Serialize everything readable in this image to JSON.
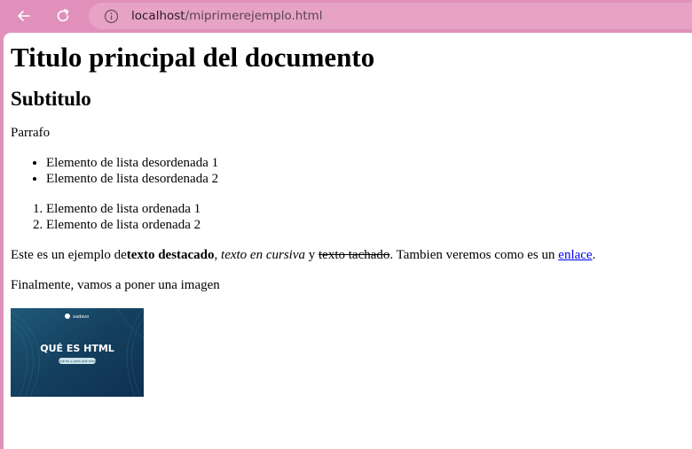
{
  "browser": {
    "url_host": "localhost",
    "url_path": "/miprimerejemplo.html"
  },
  "page": {
    "title": "Titulo principal del documento",
    "subtitle": "Subtitulo",
    "paragraph": "Parrafo",
    "unordered_list": [
      "Elemento de lista desordenada 1",
      "Elemento de lista desordenada 2"
    ],
    "ordered_list": [
      "Elemento de lista ordenada 1",
      "Elemento de lista ordenada 2"
    ],
    "example": {
      "before": "Este es un ejemplo de",
      "bold": "texto destacado",
      "sep1": ", ",
      "italic": "texto en cursiva",
      "sep2": " y ",
      "strike": "texto tachado",
      "after": ". Tambien veremos como es un ",
      "link": "enlace",
      "end": "."
    },
    "final_paragraph": "Finalmente, vamos a poner una imagen",
    "image": {
      "brand": "xadavo",
      "heading": "QUÉ ES HTML",
      "pill": "¿Qué es y para qué sirve?"
    }
  }
}
